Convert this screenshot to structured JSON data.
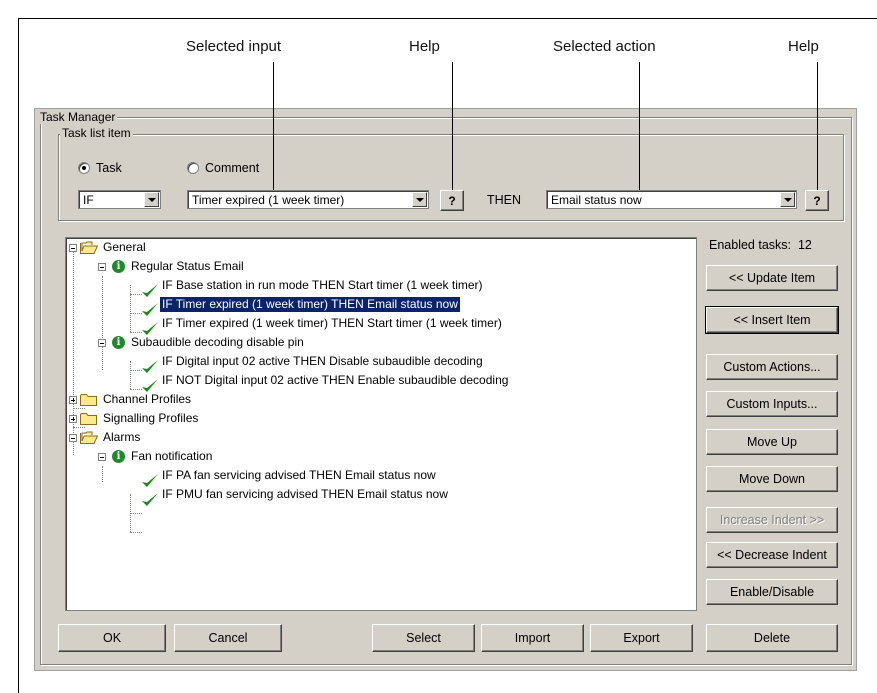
{
  "callouts": {
    "selected_input": "Selected input",
    "help1": "Help",
    "selected_action": "Selected action",
    "help2": "Help"
  },
  "dialog": {
    "title": "Task Manager",
    "task_list_item": {
      "title": "Task list item",
      "radio_task": "Task",
      "radio_comment": "Comment",
      "condition_value": "IF",
      "input_value": "Timer expired (1 week timer)",
      "help_label": "?",
      "then_label": "THEN",
      "action_value": "Email status now"
    },
    "enabled_tasks_label": "Enabled tasks:",
    "enabled_tasks_count": "12",
    "side_buttons": {
      "update_item": "<< Update Item",
      "insert_item": "<< Insert Item",
      "custom_actions": "Custom Actions...",
      "custom_inputs": "Custom Inputs...",
      "move_up": "Move Up",
      "move_down": "Move Down",
      "increase_indent": "Increase Indent >>",
      "decrease_indent": "<< Decrease Indent",
      "enable_disable": "Enable/Disable",
      "delete": "Delete"
    },
    "bottom_buttons": {
      "ok": "OK",
      "cancel": "Cancel",
      "select": "Select",
      "import": "Import",
      "export": "Export"
    },
    "tree": [
      {
        "type": "folder-open",
        "label": "General"
      },
      {
        "type": "info",
        "label": "Regular Status Email"
      },
      {
        "type": "task",
        "label": "IF Base station in run mode THEN Start timer (1 week timer)"
      },
      {
        "type": "task",
        "label": "IF Timer expired (1 week timer) THEN Email status now",
        "selected": true
      },
      {
        "type": "task",
        "label": "IF Timer expired (1 week timer) THEN Start timer (1 week timer)"
      },
      {
        "type": "info",
        "label": "Subaudible decoding disable pin"
      },
      {
        "type": "task",
        "label": "IF Digital input 02 active THEN Disable subaudible decoding"
      },
      {
        "type": "task",
        "label": "IF NOT Digital input 02 active THEN Enable subaudible decoding"
      },
      {
        "type": "folder",
        "label": "Channel Profiles"
      },
      {
        "type": "folder",
        "label": "Signalling Profiles"
      },
      {
        "type": "folder-open",
        "label": "Alarms"
      },
      {
        "type": "info",
        "label": "Fan notification"
      },
      {
        "type": "task",
        "label": "IF PA fan servicing advised THEN Email status now"
      },
      {
        "type": "task",
        "label": "IF PMU fan servicing advised THEN Email status now"
      }
    ]
  }
}
